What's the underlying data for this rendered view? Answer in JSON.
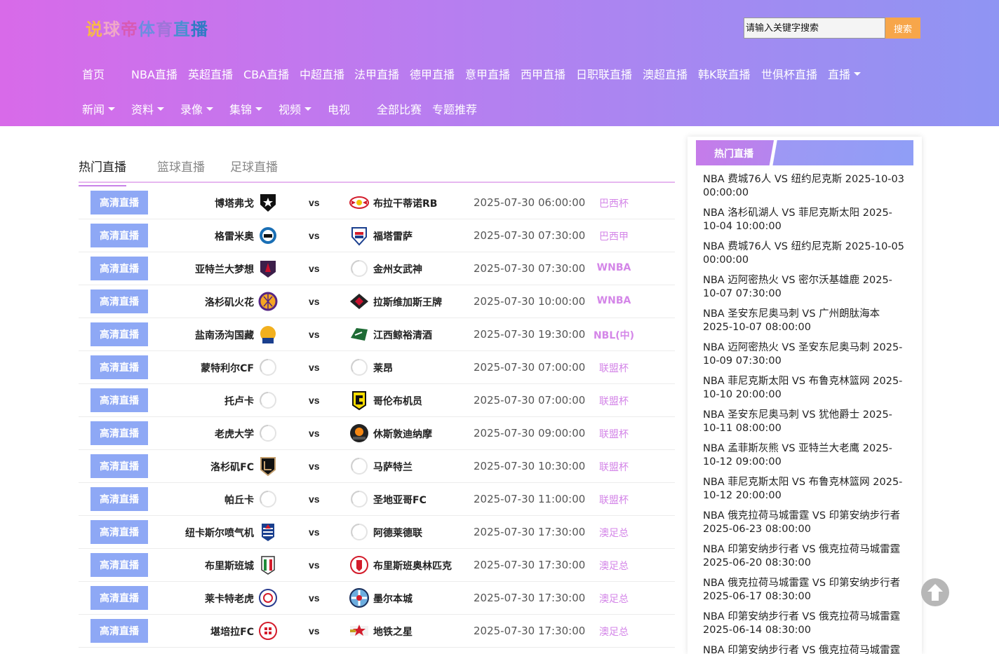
{
  "header": {
    "logo_chars": [
      {
        "ch": "说",
        "color": "#f7b84a"
      },
      {
        "ch": "球",
        "color": "#f0a7c8"
      },
      {
        "ch": "帝",
        "color": "#d85ab3"
      },
      {
        "ch": "体",
        "color": "#6d8de0"
      },
      {
        "ch": "育",
        "color": "#9f75d9"
      },
      {
        "ch": "直",
        "color": "#4a8fd1"
      },
      {
        "ch": "播",
        "color": "#2f7bc4"
      }
    ],
    "search_placeholder": "请输入关键字搜索",
    "search_button": "搜索"
  },
  "nav": {
    "row1": [
      {
        "label": "首页",
        "caret": false
      },
      {
        "label": "NBA直播",
        "caret": false
      },
      {
        "label": "英超直播",
        "caret": false
      },
      {
        "label": "CBA直播",
        "caret": false
      },
      {
        "label": "中超直播",
        "caret": false
      },
      {
        "label": "法甲直播",
        "caret": false
      },
      {
        "label": "德甲直播",
        "caret": false
      },
      {
        "label": "意甲直播",
        "caret": false
      },
      {
        "label": "西甲直播",
        "caret": false
      },
      {
        "label": "日职联直播",
        "caret": false
      },
      {
        "label": "澳超直播",
        "caret": false
      },
      {
        "label": "韩K联直播",
        "caret": false
      },
      {
        "label": "世俱杯直播",
        "caret": false
      },
      {
        "label": "直播",
        "caret": true
      }
    ],
    "row2": [
      {
        "label": "新闻",
        "caret": true
      },
      {
        "label": "资料",
        "caret": true
      },
      {
        "label": "录像",
        "caret": true
      },
      {
        "label": "集锦",
        "caret": true
      },
      {
        "label": "视频",
        "caret": true
      },
      {
        "label": "电视",
        "caret": false
      },
      {
        "label": "全部比赛",
        "caret": false
      },
      {
        "label": "专题推荐",
        "caret": false
      }
    ]
  },
  "tabs": [
    "热门直播",
    "篮球直播",
    "足球直播"
  ],
  "live_label": "高清直播",
  "vs_label": "vs",
  "matches": [
    {
      "home": "博塔弗戈",
      "away": "布拉干蒂诺RB",
      "time": "2025-07-30 06:00:00",
      "league": "巴西杯",
      "home_icon": "botafogo-logo-icon",
      "away_icon": "bragantino-logo-icon"
    },
    {
      "home": "格雷米奥",
      "away": "福塔雷萨",
      "time": "2025-07-30 07:30:00",
      "league": "巴西甲",
      "home_icon": "gremio-logo-icon",
      "away_icon": "fortaleza-logo-icon"
    },
    {
      "home": "亚特兰大梦想",
      "away": "金州女武神",
      "time": "2025-07-30 07:30:00",
      "league": "WNBA",
      "home_icon": "atlanta-dream-logo-icon",
      "away_icon": "placeholder-logo-icon"
    },
    {
      "home": "洛杉矶火花",
      "away": "拉斯维加斯王牌",
      "time": "2025-07-30 10:00:00",
      "league": "WNBA",
      "home_icon": "la-sparks-logo-icon",
      "away_icon": "las-vegas-aces-logo-icon"
    },
    {
      "home": "盐南汤沟国藏",
      "away": "江西鲸裕清酒",
      "time": "2025-07-30 19:30:00",
      "league": "NBL(中)",
      "home_icon": "yannan-logo-icon",
      "away_icon": "jiangxi-logo-icon"
    },
    {
      "home": "蒙特利尔CF",
      "away": "莱昂",
      "time": "2025-07-30 07:00:00",
      "league": "联盟杯",
      "home_icon": "placeholder-logo-icon",
      "away_icon": "placeholder-logo-icon"
    },
    {
      "home": "托卢卡",
      "away": "哥伦布机员",
      "time": "2025-07-30 07:00:00",
      "league": "联盟杯",
      "home_icon": "placeholder-logo-icon",
      "away_icon": "columbus-crew-logo-icon"
    },
    {
      "home": "老虎大学",
      "away": "休斯敦迪纳摩",
      "time": "2025-07-30 09:00:00",
      "league": "联盟杯",
      "home_icon": "placeholder-logo-icon",
      "away_icon": "houston-dynamo-logo-icon"
    },
    {
      "home": "洛杉矶FC",
      "away": "马萨特兰",
      "time": "2025-07-30 10:30:00",
      "league": "联盟杯",
      "home_icon": "lafc-logo-icon",
      "away_icon": "placeholder-logo-icon"
    },
    {
      "home": "帕丘卡",
      "away": "圣地亚哥FC",
      "time": "2025-07-30 11:00:00",
      "league": "联盟杯",
      "home_icon": "placeholder-logo-icon",
      "away_icon": "placeholder-logo-icon"
    },
    {
      "home": "纽卡斯尔喷气机",
      "away": "阿德莱德联",
      "time": "2025-07-30 17:30:00",
      "league": "澳足总",
      "home_icon": "newcastle-jets-logo-icon",
      "away_icon": "placeholder-logo-icon"
    },
    {
      "home": "布里斯班城",
      "away": "布里斯班奥林匹克",
      "time": "2025-07-30 17:30:00",
      "league": "澳足总",
      "home_icon": "brisbane-city-logo-icon",
      "away_icon": "brisbane-olympic-logo-icon"
    },
    {
      "home": "莱卡特老虎",
      "away": "墨尔本城",
      "time": "2025-07-30 17:30:00",
      "league": "澳足总",
      "home_icon": "lake-tigers-logo-icon",
      "away_icon": "melbourne-city-logo-icon"
    },
    {
      "home": "堪培拉FC",
      "away": "地铁之星",
      "time": "2025-07-30 17:30:00",
      "league": "澳足总",
      "home_icon": "canberra-fc-logo-icon",
      "away_icon": "metro-stars-logo-icon"
    }
  ],
  "sidebar": {
    "title": "热门直播",
    "items": [
      "NBA 费城76人 VS 纽约尼克斯 2025-10-03 00:00:00",
      "NBA 洛杉矶湖人 VS 菲尼克斯太阳 2025-10-04 10:00:00",
      "NBA 费城76人 VS 纽约尼克斯 2025-10-05 00:00:00",
      "NBA 迈阿密热火 VS 密尔沃基雄鹿 2025-10-07 07:30:00",
      "NBA 圣安东尼奥马刺 VS 广州朗肽海本 2025-10-07 08:00:00",
      "NBA 迈阿密热火 VS 圣安东尼奥马刺 2025-10-09 07:30:00",
      "NBA 菲尼克斯太阳 VS 布鲁克林篮网 2025-10-10 20:00:00",
      "NBA 圣安东尼奥马刺 VS 犹他爵士 2025-10-11 08:00:00",
      "NBA 孟菲斯灰熊 VS 亚特兰大老鹰 2025-10-12 09:00:00",
      "NBA 菲尼克斯太阳 VS 布鲁克林篮网 2025-10-12 20:00:00",
      "NBA 俄克拉荷马城雷霆 VS 印第安纳步行者 2025-06-23 08:00:00",
      "NBA 印第安纳步行者 VS 俄克拉荷马城雷霆 2025-06-20 08:30:00",
      "NBA 俄克拉荷马城雷霆 VS 印第安纳步行者 2025-06-17 08:30:00",
      "NBA 印第安纳步行者 VS 俄克拉荷马城雷霆 2025-06-14 08:30:00",
      "NBA 印第安纳步行者 VS 俄克拉荷马城雷霆"
    ]
  },
  "colors": {
    "header_gradient_start": "#d86ae9",
    "header_gradient_end": "#8f95f3",
    "live_button": "#8ea8f5",
    "league_text": "#d486e8",
    "search_button": "#f7a64a"
  },
  "back_to_top_icon": "arrow-up-icon"
}
